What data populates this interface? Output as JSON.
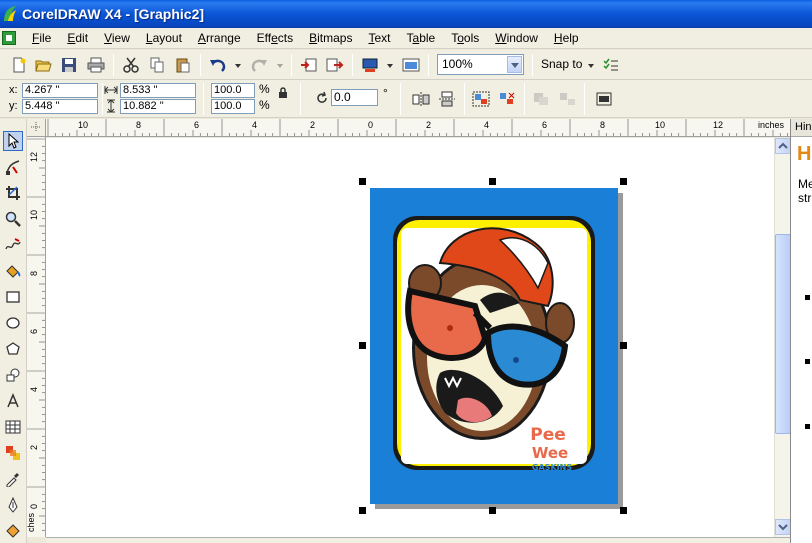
{
  "window": {
    "title": "CorelDRAW X4 - [Graphic2]"
  },
  "menu": {
    "items": [
      {
        "key": "file",
        "first": "F",
        "rest": "ile"
      },
      {
        "key": "edit",
        "first": "E",
        "rest": "dit"
      },
      {
        "key": "view",
        "first": "V",
        "rest": "iew"
      },
      {
        "key": "layout",
        "first": "L",
        "rest": "ayout"
      },
      {
        "key": "arrange",
        "first": "A",
        "rest": "rrange"
      },
      {
        "key": "effects",
        "pre": "Eff",
        "first": "e",
        "rest": "cts"
      },
      {
        "key": "bitmaps",
        "first": "B",
        "rest": "itmaps"
      },
      {
        "key": "text",
        "first": "T",
        "rest": "ext"
      },
      {
        "key": "table",
        "pre": "T",
        "first": "a",
        "rest": "ble"
      },
      {
        "key": "tools",
        "pre": "T",
        "first": "o",
        "rest": "ols"
      },
      {
        "key": "window",
        "first": "W",
        "rest": "indow"
      },
      {
        "key": "help",
        "first": "H",
        "rest": "elp"
      }
    ]
  },
  "standard_toolbar": {
    "zoom_level": "100%",
    "snap_to_label": "Snap to"
  },
  "property_bar": {
    "x_label": "x:",
    "y_label": "y:",
    "x_value": "4.267 \"",
    "y_value": "5.448 \"",
    "width_value": "8.533 \"",
    "height_value": "10.882 \"",
    "scale_x": "100.0",
    "scale_y": "100.0",
    "percent": "%",
    "rotation": "0.0",
    "degree": "°"
  },
  "ruler": {
    "units": "inches",
    "h_labels": [
      "10",
      "8",
      "6",
      "4",
      "2",
      "0",
      "2",
      "4",
      "6",
      "8",
      "10",
      "12"
    ],
    "v_labels": [
      "12",
      "10",
      "8",
      "6",
      "4",
      "2",
      "0"
    ]
  },
  "artwork": {
    "text_line1": "Pee",
    "text_line2": "Wee",
    "text_line3": "GASKINS",
    "background_color": "#1a7fd6",
    "frame_color": "#ffef00",
    "orange": "#e86a4a",
    "blue_text": "#2a8ad4"
  },
  "docker": {
    "tab_label": "Hin",
    "heading": "H",
    "line1": "Me",
    "line2": "str"
  },
  "bottom": {
    "corner_label": "ches"
  }
}
